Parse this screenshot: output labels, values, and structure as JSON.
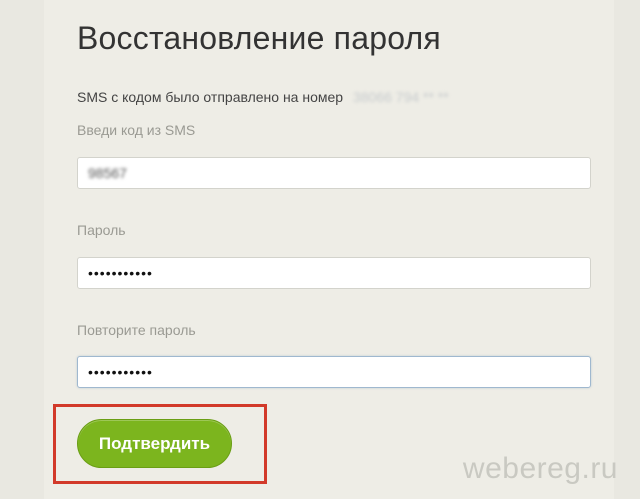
{
  "form": {
    "title": "Восстановление пароля",
    "sms_notice": "SMS с кодом было отправлено на номер",
    "phone_number_masked": "38066 794 ** **",
    "code_label": "Введи код из SMS",
    "code_value": "98567",
    "password_label": "Пароль",
    "password_value": "•••••••••••",
    "repeat_label": "Повторите пароль",
    "repeat_value": "•••••••••••",
    "submit_label": "Подтвердить"
  },
  "watermark": "webereg.ru",
  "colors": {
    "background": "#e9e8e1",
    "button": "#7cb51e",
    "highlight": "#d23a2a"
  }
}
